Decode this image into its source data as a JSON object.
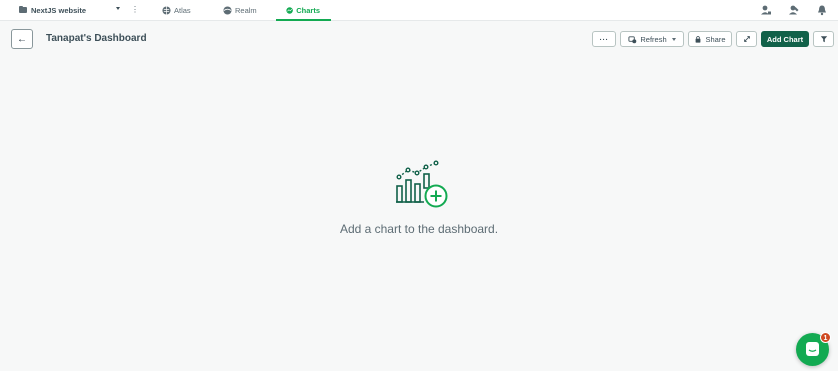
{
  "nav": {
    "project_name": "NextJS website",
    "tabs": [
      {
        "label": "Atlas",
        "icon": "atlas-icon"
      },
      {
        "label": "Realm",
        "icon": "realm-icon"
      },
      {
        "label": "Charts",
        "icon": "charts-icon",
        "active": true
      }
    ],
    "right_icons": [
      "user-access-icon",
      "activity-icon",
      "bell-icon"
    ]
  },
  "header": {
    "title": "Tanapat's Dashboard",
    "more_label": "···",
    "refresh_label": "Refresh",
    "share_label": "Share",
    "add_chart_label": "Add Chart"
  },
  "empty_state": {
    "message": "Add a chart to the dashboard."
  },
  "chat": {
    "unread_count": "1"
  },
  "colors": {
    "accent": "#13aa52",
    "primary_button": "#116149",
    "badge": "#cf4a22"
  }
}
